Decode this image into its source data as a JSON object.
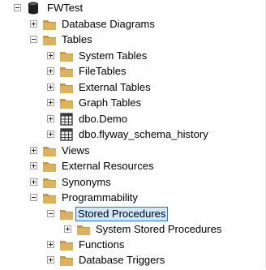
{
  "tree": {
    "database": {
      "label": "FWTest",
      "icon": "database-icon",
      "state": "expanded"
    },
    "nodes": [
      {
        "label": "Database Diagrams",
        "icon": "folder-icon",
        "state": "collapsed"
      },
      {
        "label": "Tables",
        "icon": "folder-icon",
        "state": "expanded"
      },
      {
        "label": "System Tables",
        "icon": "folder-icon",
        "state": "collapsed"
      },
      {
        "label": "FileTables",
        "icon": "folder-icon",
        "state": "collapsed"
      },
      {
        "label": "External Tables",
        "icon": "folder-icon",
        "state": "collapsed"
      },
      {
        "label": "Graph Tables",
        "icon": "folder-icon",
        "state": "collapsed"
      },
      {
        "label": "dbo.Demo",
        "icon": "table-icon",
        "state": "collapsed"
      },
      {
        "label": "dbo.flyway_schema_history",
        "icon": "table-icon",
        "state": "collapsed"
      },
      {
        "label": "Views",
        "icon": "folder-icon",
        "state": "collapsed"
      },
      {
        "label": "External Resources",
        "icon": "folder-icon",
        "state": "collapsed"
      },
      {
        "label": "Synonyms",
        "icon": "folder-icon",
        "state": "collapsed"
      },
      {
        "label": "Programmability",
        "icon": "folder-icon",
        "state": "expanded"
      },
      {
        "label": "Stored Procedures",
        "icon": "folder-icon",
        "state": "expanded",
        "selected": true
      },
      {
        "label": "System Stored Procedures",
        "icon": "folder-icon",
        "state": "collapsed"
      },
      {
        "label": "Functions",
        "icon": "folder-icon",
        "state": "collapsed"
      },
      {
        "label": "Database Triggers",
        "icon": "folder-icon",
        "state": "collapsed"
      }
    ]
  },
  "colors": {
    "folder": "#dcb35c",
    "folder_dark": "#c89a3c",
    "selection_bg": "#cde8ff",
    "selection_border": "#2f78c8"
  }
}
